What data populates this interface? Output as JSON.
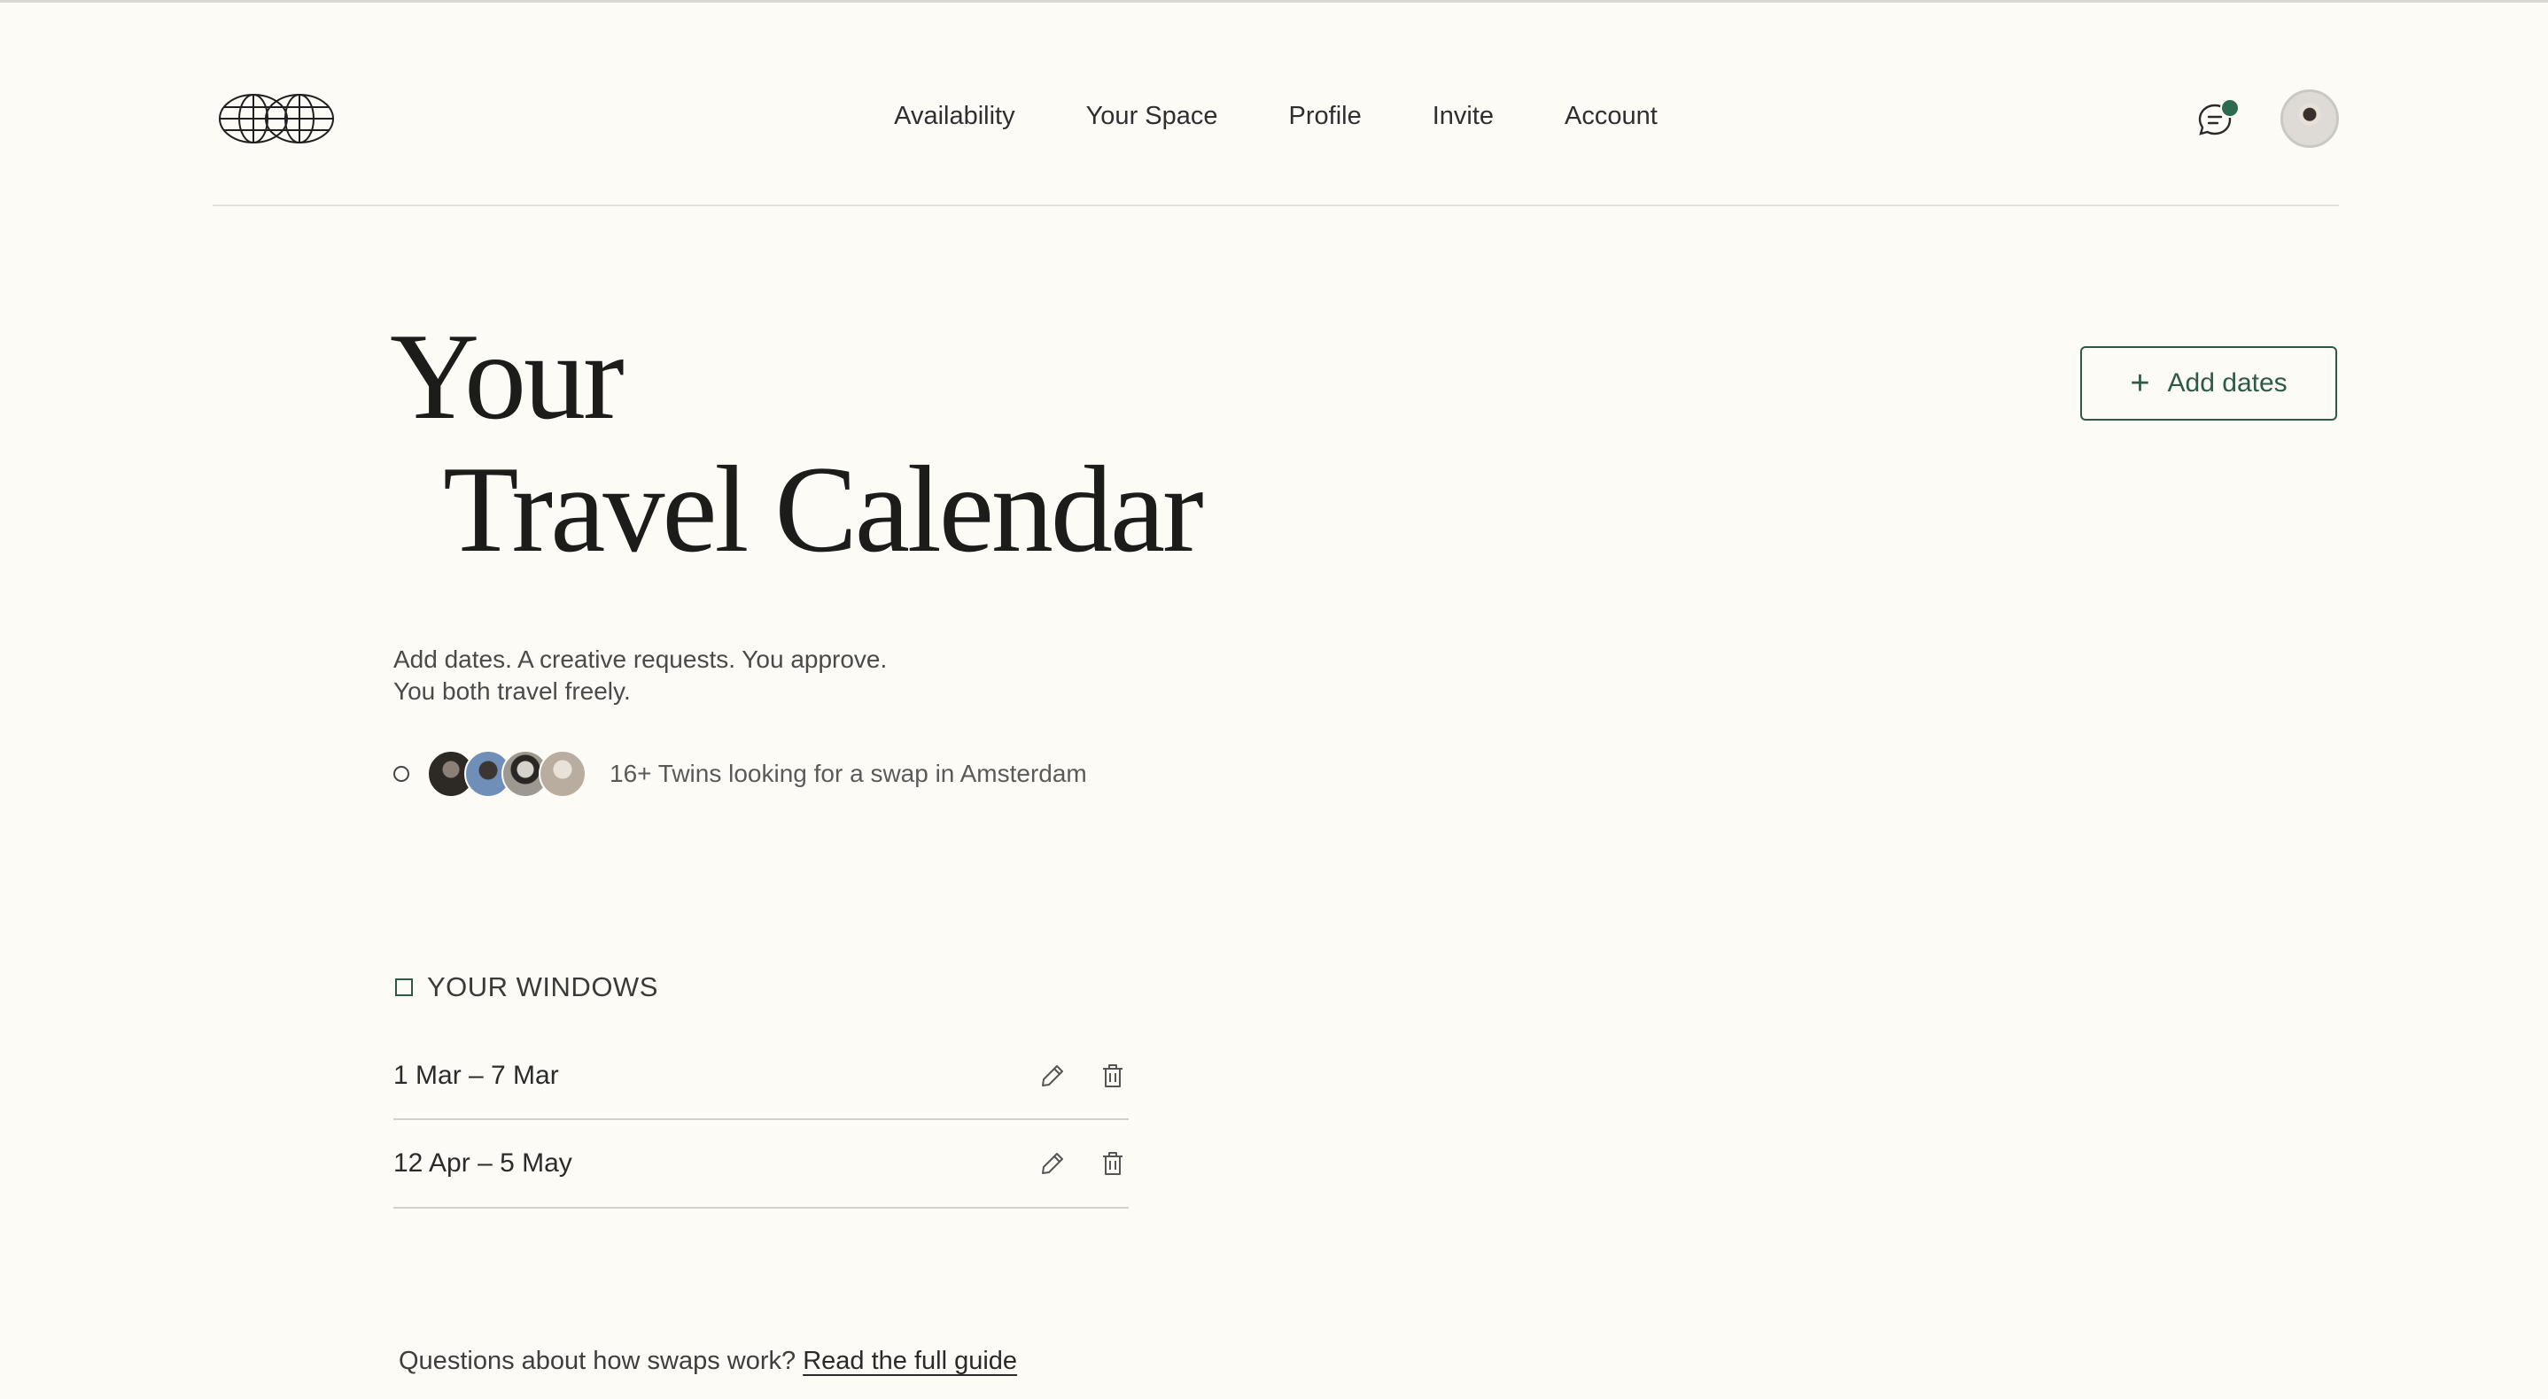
{
  "nav": {
    "items": [
      "Availability",
      "Your Space",
      "Profile",
      "Invite",
      "Account"
    ]
  },
  "header": {
    "logo_icon": "globe-logo-icon",
    "chat_icon": "chat-icon",
    "notification_color": "#2e6a4f"
  },
  "hero": {
    "title_line1": "Your",
    "title_line2": "Travel Calendar",
    "subtitle_line1": "Add dates. A creative requests. You approve.",
    "subtitle_line2": "You both travel freely.",
    "twins_text": "16+ Twins looking for a swap in Amsterdam"
  },
  "actions": {
    "add_dates_label": "Add dates",
    "accent_color": "#2e5a45"
  },
  "windows": {
    "heading": "YOUR WINDOWS",
    "items": [
      {
        "range": "1 Mar – 7 Mar"
      },
      {
        "range": "12 Apr – 5 May"
      }
    ]
  },
  "footer": {
    "question": "Questions about how swaps work?",
    "link_label": "Read the full guide"
  }
}
